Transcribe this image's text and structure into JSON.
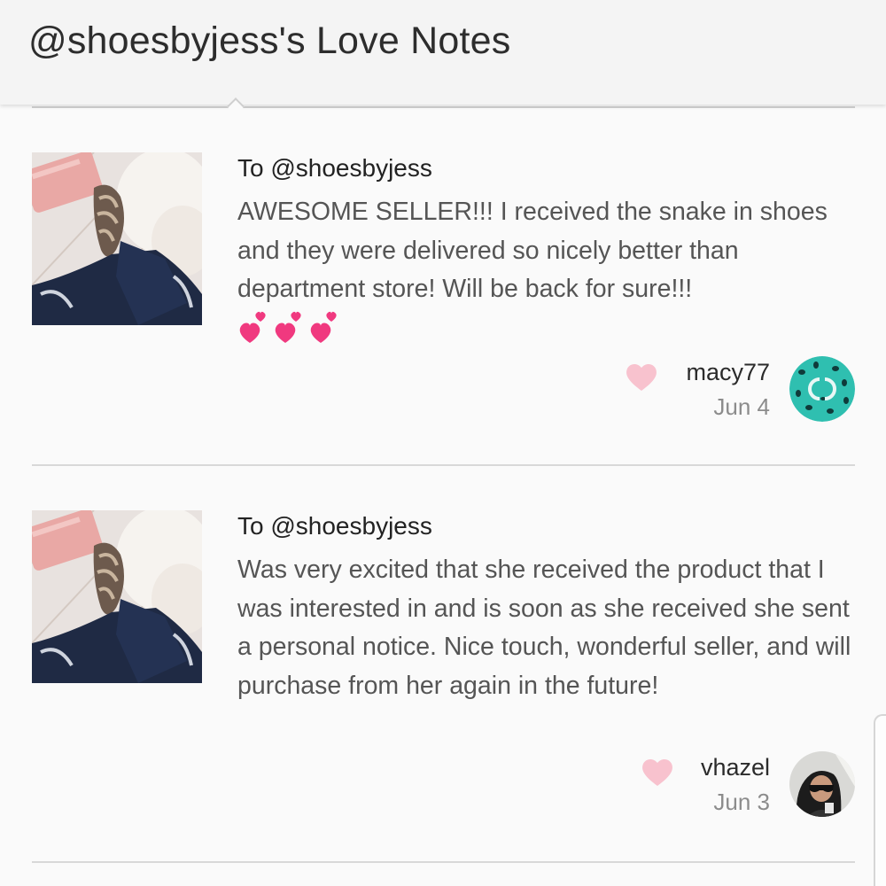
{
  "header": {
    "title": "@shoesbyjess's Love Notes"
  },
  "notes": [
    {
      "to": "To @shoesbyjess",
      "text": "AWESOME SELLER!!! I received the snake in shoes and they were delivered so nicely better than department store! Will be back for sure!!!",
      "emoji": "💕💕💕",
      "username": "macy77",
      "date": "Jun 4",
      "avatar_icon": "teal-leopard-logo-avatar"
    },
    {
      "to": "To @shoesbyjess",
      "text": "Was very excited that she received the product that I was interested in and is soon as she received she sent a personal notice. Nice touch, wonderful seller, and will purchase from her again in the future!",
      "username": "vhazel",
      "date": "Jun 3",
      "avatar_icon": "woman-sunglasses-photo-avatar"
    }
  ],
  "colors": {
    "heart": "#f8c2ce",
    "emoji_heart": "#f0397f",
    "avatar_teal": "#2fbfb0"
  }
}
